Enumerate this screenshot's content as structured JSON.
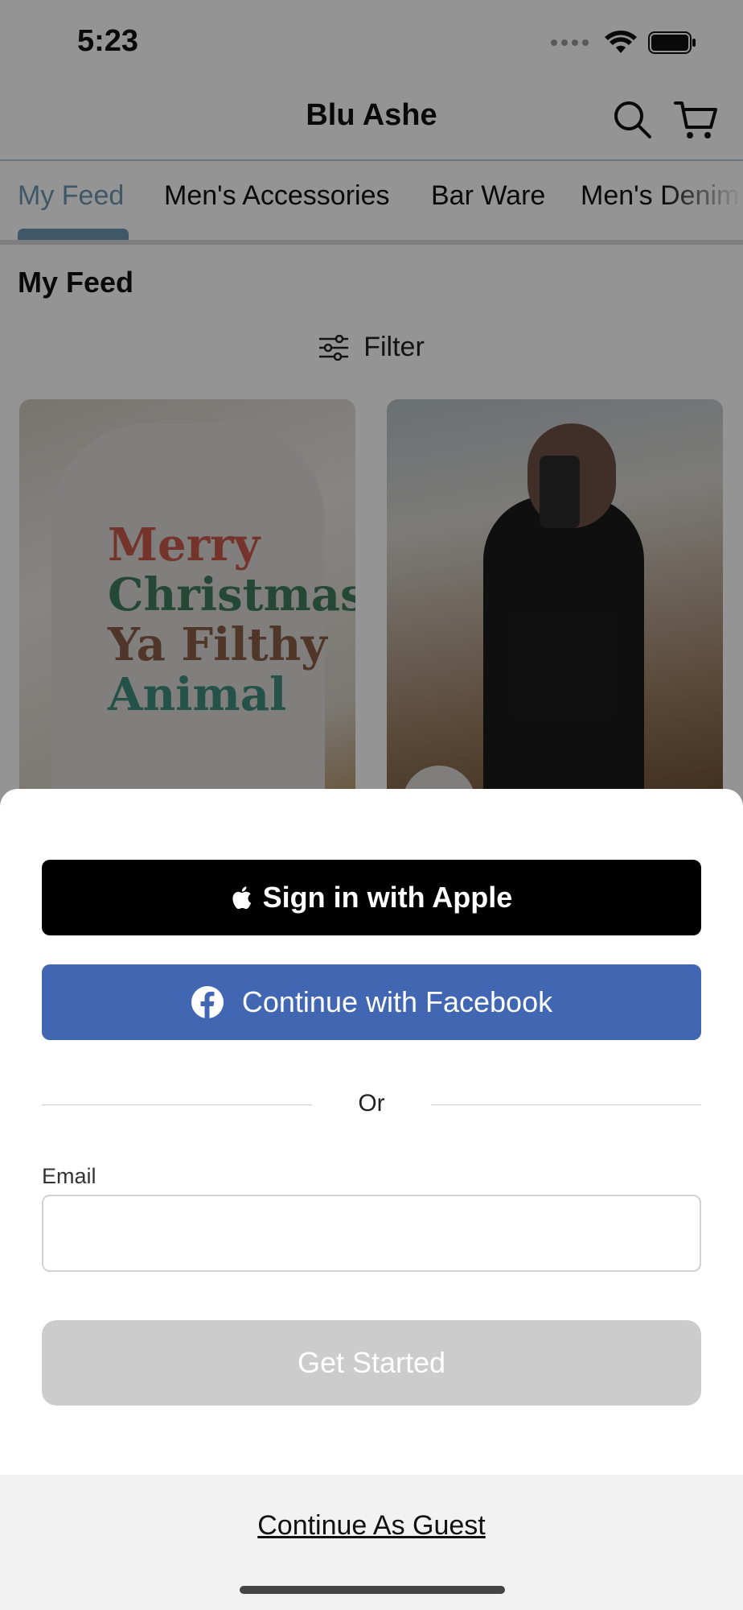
{
  "status_bar": {
    "time": "5:23"
  },
  "nav": {
    "title": "Blu Ashe",
    "search_icon": "search-icon",
    "cart_icon": "cart-icon"
  },
  "tabs": [
    {
      "label": "My Feed",
      "active": true
    },
    {
      "label": "Men's Accessories",
      "active": false
    },
    {
      "label": "Bar Ware",
      "active": false
    },
    {
      "label": "Men's Denim",
      "active": false
    }
  ],
  "feed": {
    "heading": "My Feed",
    "filter_label": "Filter"
  },
  "products": [
    {
      "name": "Merry Christmas Ya Filthy Animal sweatshirt",
      "print_lines": [
        "Merry",
        "Christmas",
        "Ya Filthy",
        "Animal"
      ]
    },
    {
      "name": "Black pullover video post",
      "has_video": true
    }
  ],
  "sheet": {
    "apple_button": "Sign in with Apple",
    "facebook_button": "Continue with Facebook",
    "divider": "Or",
    "email_label": "Email",
    "email_value": "",
    "email_placeholder": "",
    "get_started_button": "Get Started",
    "guest_link": "Continue As Guest"
  },
  "colors": {
    "accent": "#6f96b2",
    "facebook": "#4267b2",
    "apple": "#000000",
    "disabled_button": "#cccccc",
    "overlay": "rgba(0,0,0,0.42)"
  }
}
